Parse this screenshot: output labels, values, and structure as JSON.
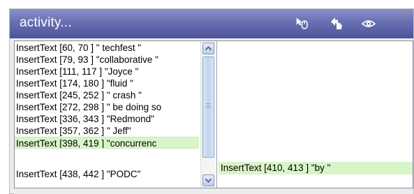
{
  "panel": {
    "title": "activity...",
    "toolbar_icons": [
      "mouse-cursor-icon",
      "hand-pointer-icon",
      "eye-icon"
    ]
  },
  "activity_list": {
    "items": [
      "InsertText [60, 70 ] \" techfest \"",
      "InsertText [79, 93 ] \"collaborative \"",
      "InsertText [111, 117 ] \"Joyce \"",
      "InsertText [174, 180 ] \"fluid \"",
      "InsertText [245, 252 ] \" crash \"",
      "InsertText [272, 298 ] \" be doing so",
      "InsertText [336, 343 ] \"Redmond\"",
      "InsertText [357, 362 ] \" Jeff\"",
      "InsertText [398, 419 ] \"concurrenc",
      "InsertText [438, 442 ] \"PODC\""
    ],
    "selected_index": 8
  },
  "detail": {
    "selected_item": "InsertText [410, 413 ] \"by \""
  },
  "colors": {
    "titlebar": "#5c63a8",
    "selection": "#d8f5c8"
  }
}
